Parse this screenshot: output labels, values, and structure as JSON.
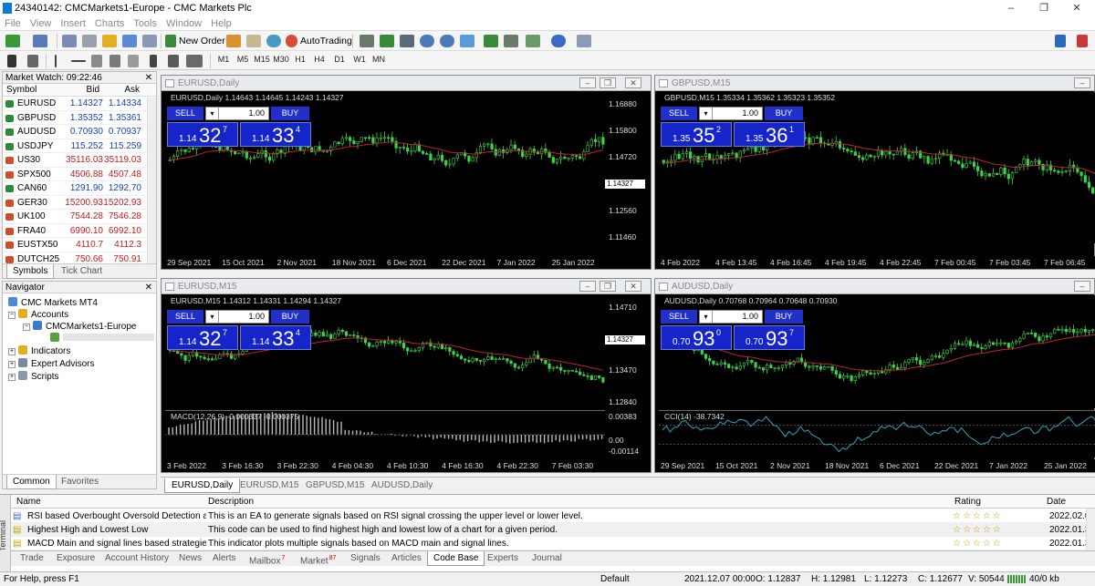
{
  "window": {
    "title": "24340142: CMCMarkets1-Europe - CMC Markets Plc",
    "min": "–",
    "max": "❐",
    "close": "✕"
  },
  "menu": [
    "File",
    "View",
    "Insert",
    "Charts",
    "Tools",
    "Window",
    "Help"
  ],
  "toolbar": {
    "new_order": "New Order",
    "autotrading": "AutoTrading",
    "timeframes": [
      "M1",
      "M5",
      "M15",
      "M30",
      "H1",
      "H4",
      "D1",
      "W1",
      "MN"
    ]
  },
  "market_watch": {
    "title": "Market Watch: 09:22:46",
    "columns": {
      "symbol": "Symbol",
      "bid": "Bid",
      "ask": "Ask"
    },
    "rows": [
      {
        "symbol": "EURUSD",
        "bid": "1.14327",
        "ask": "1.14334",
        "dir": "up"
      },
      {
        "symbol": "GBPUSD",
        "bid": "1.35352",
        "ask": "1.35361",
        "dir": "up"
      },
      {
        "symbol": "AUDUSD",
        "bid": "0.70930",
        "ask": "0.70937",
        "dir": "up"
      },
      {
        "symbol": "USDJPY",
        "bid": "115.252",
        "ask": "115.259",
        "dir": "up"
      },
      {
        "symbol": "US30",
        "bid": "35116.03",
        "ask": "35119.03",
        "dir": "dn"
      },
      {
        "symbol": "SPX500",
        "bid": "4506.88",
        "ask": "4507.48",
        "dir": "dn"
      },
      {
        "symbol": "CAN60",
        "bid": "1291.90",
        "ask": "1292.70",
        "dir": "up"
      },
      {
        "symbol": "GER30",
        "bid": "15200.93",
        "ask": "15202.93",
        "dir": "dn"
      },
      {
        "symbol": "UK100",
        "bid": "7544.28",
        "ask": "7546.28",
        "dir": "dn"
      },
      {
        "symbol": "FRA40",
        "bid": "6990.10",
        "ask": "6992.10",
        "dir": "dn"
      },
      {
        "symbol": "EUSTX50",
        "bid": "4110.7",
        "ask": "4112.3",
        "dir": "dn"
      },
      {
        "symbol": "DUTCH25",
        "bid": "750.66",
        "ask": "750.91",
        "dir": "dn"
      }
    ],
    "tabs": [
      "Symbols",
      "Tick Chart"
    ]
  },
  "navigator": {
    "title": "Navigator",
    "root": "CMC Markets MT4",
    "accounts": "Accounts",
    "server": "CMCMarkets1-Europe",
    "items": [
      "Indicators",
      "Expert Advisors",
      "Scripts"
    ],
    "tabs": [
      "Common",
      "Favorites"
    ]
  },
  "charts": [
    {
      "title": "EURUSD,Daily",
      "ohlc": "EURUSD,Daily  1.14643 1.14645 1.14243 1.14327",
      "lot": "1.00",
      "sell": {
        "small": "1.14",
        "big": "32",
        "sup": "7"
      },
      "buy": {
        "small": "1.14",
        "big": "33",
        "sup": "4"
      },
      "yticks": [
        "1.16880",
        "1.15800",
        "1.14720",
        "1.13640",
        "1.12560",
        "1.11460"
      ],
      "last": "1.14327",
      "xticks": [
        "29 Sep 2021",
        "15 Oct 2021",
        "2 Nov 2021",
        "18 Nov 2021",
        "6 Dec 2021",
        "22 Dec 2021",
        "7 Jan 2022",
        "25 Jan 2022"
      ]
    },
    {
      "title": "GBPUSD,M15",
      "ohlc": "GBPUSD,M15  1.35334 1.35362 1.35323 1.35352",
      "lot": "1.00",
      "sell": {
        "small": "1.35",
        "big": "35",
        "sup": "2"
      },
      "buy": {
        "small": "1.35",
        "big": "36",
        "sup": "1"
      },
      "xticks": [
        "4 Feb 2022",
        "4 Feb 13:45",
        "4 Feb 16:45",
        "4 Feb 19:45",
        "4 Feb 22:45",
        "7 Feb 00:45",
        "7 Feb 03:45",
        "7 Feb 06:45"
      ]
    },
    {
      "title": "EURUSD,M15",
      "ohlc": "EURUSD,M15  1.14312 1.14331 1.14294 1.14327",
      "lot": "1.00",
      "sell": {
        "small": "1.14",
        "big": "32",
        "sup": "7"
      },
      "buy": {
        "small": "1.14",
        "big": "33",
        "sup": "4"
      },
      "yticks": [
        "1.14710",
        "1.14090",
        "1.13470",
        "1.12840"
      ],
      "last": "1.14327",
      "macd": "MACD(12,26,9) -0.000337 -0.000375",
      "macd_ticks": [
        "0.00383",
        "0.00",
        "-0.00114"
      ],
      "xticks": [
        "3 Feb 2022",
        "3 Feb 16:30",
        "3 Feb 22:30",
        "4 Feb 04:30",
        "4 Feb 10:30",
        "4 Feb 16:30",
        "4 Feb 22:30",
        "7 Feb 03:30"
      ]
    },
    {
      "title": "AUDUSD,Daily",
      "ohlc": "AUDUSD,Daily  0.70768 0.70964 0.70648 0.70930",
      "lot": "1.00",
      "sell": {
        "small": "0.70",
        "big": "93",
        "sup": "0"
      },
      "buy": {
        "small": "0.70",
        "big": "93",
        "sup": "7"
      },
      "cci": "CCI(14) -38.7342",
      "xticks": [
        "29 Sep 2021",
        "15 Oct 2021",
        "2 Nov 2021",
        "18 Nov 2021",
        "6 Dec 2021",
        "22 Dec 2021",
        "7 Jan 2022",
        "25 Jan 2022"
      ]
    }
  ],
  "trade_labels": {
    "sell": "SELL",
    "buy": "BUY"
  },
  "chart_tabs": [
    "EURUSD,Daily",
    "EURUSD,M15",
    "GBPUSD,M15",
    "AUDUSD,Daily"
  ],
  "terminal": {
    "side_label": "Terminal",
    "columns": {
      "name": "Name",
      "description": "Description",
      "rating": "Rating",
      "date": "Date"
    },
    "rows": [
      {
        "name": "RSI based Overbought Oversold Detection a...",
        "description": "This is an EA to generate signals based on RSI signal crossing the upper level or lower level.",
        "rating": "☆☆☆☆☆",
        "date": "2022.02.01"
      },
      {
        "name": "Highest High and Lowest Low",
        "description": "This code can be used to find highest high and lowest low of a chart for a given period.",
        "rating": "☆☆☆☆☆",
        "date": "2022.01.30"
      },
      {
        "name": "MACD Main and signal lines based strategies",
        "description": "This indicator plots multiple signals based on MACD main and signal lines.",
        "rating": "☆☆☆☆☆",
        "date": "2022.01.30"
      }
    ],
    "tabs": [
      "Trade",
      "Exposure",
      "Account History",
      "News",
      "Alerts",
      "Mailbox",
      "Market",
      "Signals",
      "Articles",
      "Code Base",
      "Experts",
      "Journal"
    ],
    "mailbox_badge": "7",
    "market_badge": "87"
  },
  "status": {
    "help": "For Help, press F1",
    "profile": "Default",
    "datetime": "2021.12.07 00:00",
    "open": "O: 1.12837",
    "high": "H: 1.12981",
    "low": "L: 1.12273",
    "close": "C: 1.12677",
    "volume": "V: 50544",
    "traffic": "40/0 kb"
  }
}
